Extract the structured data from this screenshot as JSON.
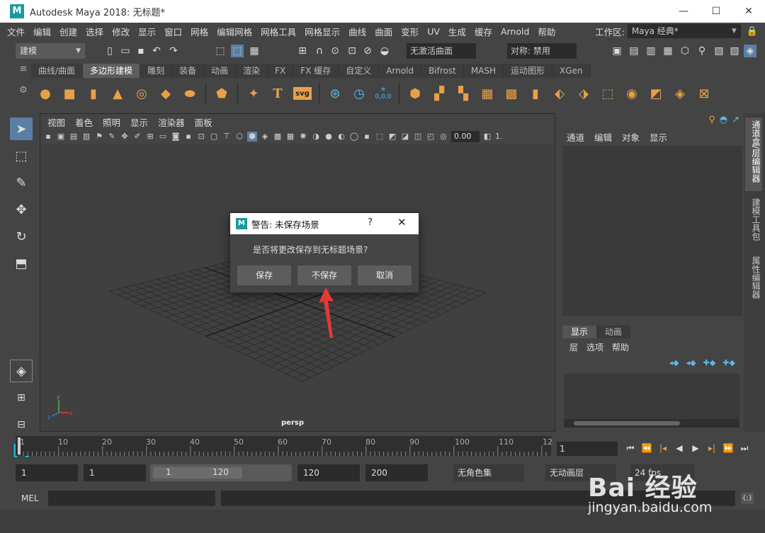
{
  "window": {
    "title": "Autodesk Maya 2018: 无标题*",
    "logo_letter": "M",
    "min": "—",
    "max": "☐",
    "close": "✕"
  },
  "menubar": {
    "items": [
      "文件",
      "编辑",
      "创建",
      "选择",
      "修改",
      "显示",
      "窗口",
      "网格",
      "编辑网格",
      "网格工具",
      "网格显示",
      "曲线",
      "曲面",
      "变形",
      "UV",
      "生成",
      "缓存",
      "Arnold",
      "帮助"
    ]
  },
  "workspace": {
    "label": "工作区:",
    "value": "Maya 经典*"
  },
  "statusline": {
    "mode": "建模",
    "live_surface": "无激活曲面",
    "symmetry": "对称: 禁用"
  },
  "shelf": {
    "tabs": [
      "曲线/曲面",
      "多边形建模",
      "雕刻",
      "装备",
      "动画",
      "渲染",
      "FX",
      "FX 缓存",
      "自定义",
      "Arnold",
      "Bifrost",
      "MASH",
      "运动图形",
      "XGen"
    ],
    "active_tab": 1,
    "svg_label": "svg",
    "text_label": "T",
    "coord_label": "0,0,0"
  },
  "viewport": {
    "menu": [
      "视图",
      "着色",
      "照明",
      "显示",
      "渲染器",
      "面板"
    ],
    "exposure": "0.00",
    "gamma_suffix": "1.",
    "camera": "persp",
    "axis_y": "y",
    "axis_x": "x",
    "axis_z": "z"
  },
  "channelbox": {
    "menu": [
      "通道",
      "编辑",
      "对象",
      "显示"
    ],
    "layer_tabs": [
      "显示",
      "动画"
    ],
    "layer_menu": [
      "层",
      "选项",
      "帮助"
    ]
  },
  "sidetabs": [
    "通道盒/层编辑器",
    "建模工具包",
    "属性编辑器"
  ],
  "timeslider": {
    "ticks": [
      "1",
      "10",
      "20",
      "30",
      "40",
      "50",
      "60",
      "70",
      "80",
      "90",
      "100",
      "110",
      "12"
    ],
    "current_frame": "1"
  },
  "range": {
    "start": "1",
    "playback_start": "1",
    "bar_start": "1",
    "bar_end": "120",
    "playback_end": "120",
    "end": "200",
    "character_set": "无角色集",
    "anim_layer": "无动画层",
    "fps": "24 fps"
  },
  "cmdline": {
    "label": "MEL",
    "script_icon": "{;}"
  },
  "dialog": {
    "title": "警告: 未保存场景",
    "help": "?",
    "close": "✕",
    "message": "是否将更改保存到无标题场景?",
    "buttons": [
      "保存",
      "不保存",
      "取消"
    ]
  },
  "watermark": {
    "brand": "Bai 经验",
    "url": "jingyan.baidu.com"
  },
  "colors": {
    "accent": "#1a9aa0",
    "panel": "#444444",
    "arrow": "#e53935",
    "active_tool": "#5b7fa3"
  }
}
